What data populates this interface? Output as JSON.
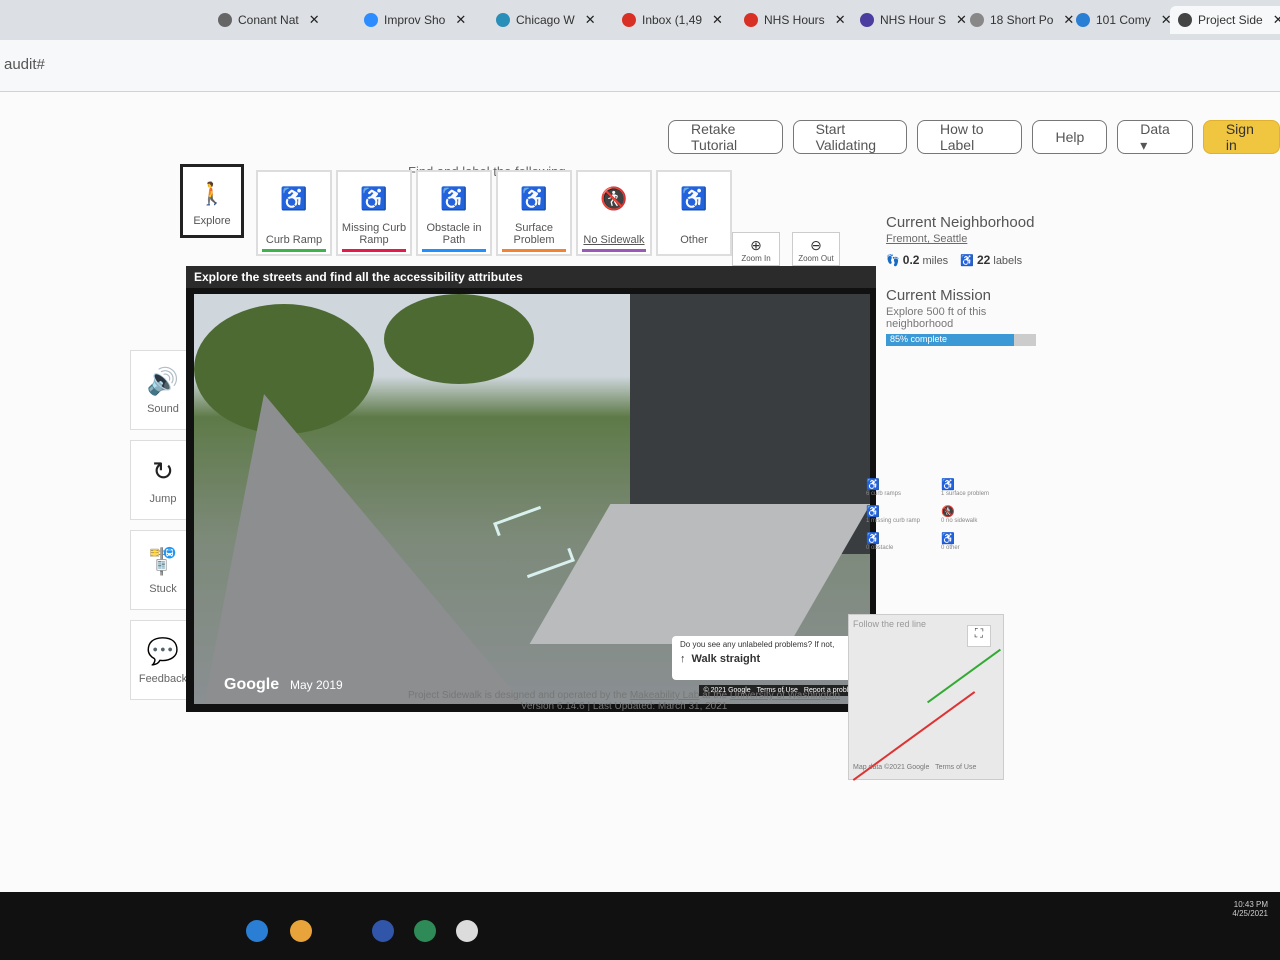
{
  "browser": {
    "tabs": [
      {
        "label": "Conant Nat",
        "color": "#666"
      },
      {
        "label": "Improv Sho",
        "color": "#2d8cff"
      },
      {
        "label": "Chicago W",
        "color": "#2a8fb8"
      },
      {
        "label": "Inbox (1,49",
        "color": "#d93025"
      },
      {
        "label": "NHS Hours",
        "color": "#d93025"
      },
      {
        "label": "NHS Hour S",
        "color": "#4b3ca0"
      },
      {
        "label": "18 Short Po",
        "color": "#888"
      },
      {
        "label": "101 Comy",
        "color": "#2a7fd4"
      },
      {
        "label": "Project Side",
        "color": "#444"
      }
    ],
    "url": "audit#"
  },
  "nav": {
    "retake": "Retake Tutorial",
    "validate": "Start Validating",
    "howto": "How to Label",
    "help": "Help",
    "data": "Data ▾",
    "signin": "Sign in"
  },
  "toolbar": {
    "find_label": "Find and label the following",
    "explore": "Explore",
    "tools": [
      {
        "label": "Curb Ramp",
        "color": "#3cb44b"
      },
      {
        "label": "Missing Curb Ramp",
        "color": "#e6194b"
      },
      {
        "label": "Obstacle in Path",
        "color": "#1e90ff"
      },
      {
        "label": "Surface Problem",
        "color": "#f58231"
      },
      {
        "label": "No Sidewalk",
        "color": "#9b59b6"
      },
      {
        "label": "Other",
        "color": ""
      }
    ],
    "zoom_in": "Zoom In",
    "zoom_out": "Zoom Out"
  },
  "sidebar": {
    "sound": "Sound",
    "jump": "Jump",
    "stuck": "Stuck",
    "feedback": "Feedback"
  },
  "streetview": {
    "header": "Explore the streets and find all the accessibility attributes",
    "google": "Google",
    "date": "May 2019",
    "prompt": "Do you see any unlabeled problems? If not,",
    "walk": "Walk straight",
    "legal": [
      "© 2021 Google",
      "Terms of Use",
      "Report a problem"
    ]
  },
  "panel": {
    "neighborhood_title": "Current Neighborhood",
    "neighborhood": "Fremont, Seattle",
    "miles_value": "0.2",
    "miles_unit": "miles",
    "labels_value": "22",
    "labels_unit": "labels",
    "mission_title": "Current Mission",
    "mission_text": "Explore 500 ft of this neighborhood",
    "progress_text": "85% complete",
    "progress_pct": 85,
    "counts": [
      "6 curb ramps",
      "1 surface problem",
      "1 missing curb ramp",
      "0 no sidewalk",
      "0 obstacle",
      "0 other"
    ]
  },
  "minimap": {
    "follow": "Follow the red line",
    "mapdata": "Map data ©2021 Google",
    "terms": "Terms of Use"
  },
  "footer": {
    "line1_prefix": "Project Sidewalk is designed and operated by the",
    "lab": "Makeability Lab",
    "mid": "at the",
    "uni": "University of Washington",
    "version": "Version 6.14.6 | Last Updated: March 31, 2021"
  },
  "taskbar": {
    "time": "10:43 PM",
    "date": "4/25/2021"
  }
}
